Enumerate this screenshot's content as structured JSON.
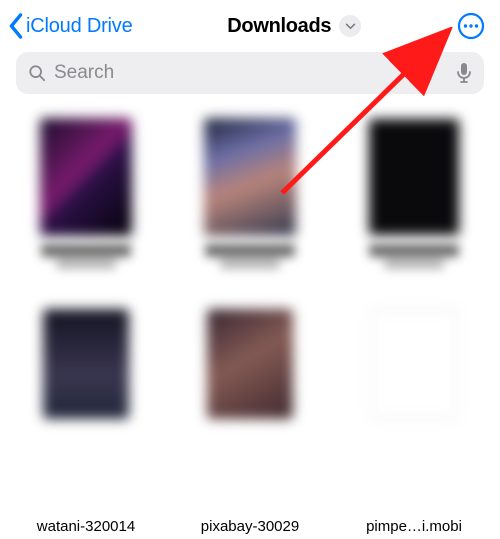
{
  "nav": {
    "back_label": "iCloud Drive",
    "title": "Downloads",
    "accent_color": "#007aff"
  },
  "search": {
    "placeholder": "Search"
  },
  "files": {
    "row2_labels": [
      "watani-320014",
      "pixabay-30029",
      "pimpe…i.mobi"
    ]
  }
}
